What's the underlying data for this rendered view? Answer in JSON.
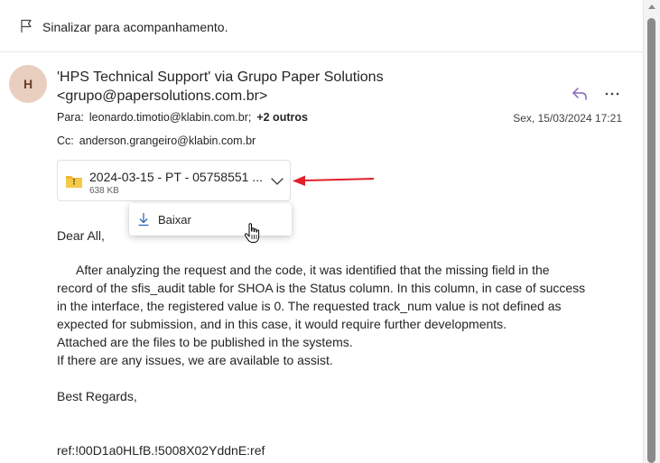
{
  "flag": {
    "text": "Sinalizar para acompanhamento."
  },
  "header": {
    "avatar_initial": "H",
    "sender_name": "'HPS Technical Support' via Grupo Paper Solutions",
    "sender_email": "<grupo@papersolutions.com.br>",
    "to_label": "Para:",
    "to_address": "leonardo.timotio@klabin.com.br;",
    "to_others": "+2 outros",
    "date": "Sex, 15/03/2024 17:21",
    "cc_label": "Cc:",
    "cc_address": "anderson.grangeiro@klabin.com.br"
  },
  "attachment": {
    "name": "2024-03-15 - PT - 05758551 ...",
    "size": "638 KB",
    "icon": "zip-folder-icon"
  },
  "dropdown": {
    "download_label": "Baixar"
  },
  "body": {
    "greeting": "Dear All,",
    "paragraph_lines": [
      "After analyzing the request and the code, it was identified that the missing field in the",
      "record of the sfis_audit table for SHOA is the Status column. In this column, in case of success",
      "in the interface, the registered value is 0. The requested track_num value is not defined as",
      "expected for submission, and in this case, it would require further developments.",
      "Attached are the files to be published in the systems.",
      "If there are any issues, we are available to assist."
    ],
    "regards": "Best Regards,",
    "ref": "ref:!00D1a0HLfB.!5008X02YddnE:ref"
  },
  "colors": {
    "reply_icon": "#8764b8",
    "annotation_arrow": "#e0202a",
    "avatar_bg": "#e8cfc0",
    "zip_icon": "#f2b632"
  }
}
